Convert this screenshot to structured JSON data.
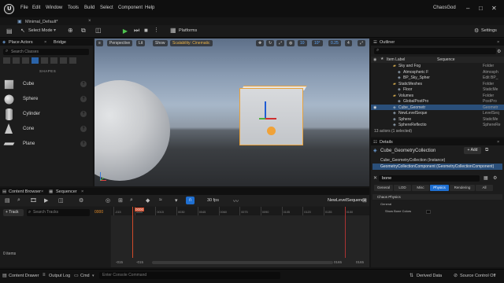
{
  "menubar": {
    "items": [
      "File",
      "Edit",
      "Window",
      "Tools",
      "Build",
      "Select",
      "Component",
      "Help"
    ],
    "project_tab": "Minimal_Default*",
    "window_title": "ChaosGod"
  },
  "toolbar": {
    "select_mode": "Select Mode",
    "platforms": "Platforms",
    "settings": "Settings"
  },
  "place_actors": {
    "tab_label": "Place Actors",
    "bridge_tab": "Bridge",
    "search_placeholder": "Search Classes",
    "section": "SHAPES",
    "shapes": [
      {
        "name": "Cube",
        "icon": "cube-icon"
      },
      {
        "name": "Sphere",
        "icon": "sphere-icon"
      },
      {
        "name": "Cylinder",
        "icon": "cylinder-icon"
      },
      {
        "name": "Cone",
        "icon": "cone-icon"
      },
      {
        "name": "Plane",
        "icon": "plane-icon"
      }
    ]
  },
  "viewport": {
    "perspective": "Perspective",
    "lit": "Lit",
    "show": "Show",
    "scalability": "Scalability: Cinematic",
    "grid_snap": "10",
    "rotation_snap": "10°",
    "scale_snap": "0.25",
    "camera_speed": "4"
  },
  "outliner": {
    "tab_label": "Outliner",
    "col_label": "Item Label",
    "col_sequence": "Sequence",
    "rows": [
      {
        "name": "Sky and Fog",
        "type": "Folder",
        "indent": 1
      },
      {
        "name": "Atmospheric F",
        "type": "Atmosph",
        "indent": 2
      },
      {
        "name": "BP_Sky_Spher",
        "type": "Edit BP_",
        "indent": 2
      },
      {
        "name": "StaticMeshes",
        "type": "Folder",
        "indent": 1
      },
      {
        "name": "Floor",
        "type": "StaticMe",
        "indent": 2
      },
      {
        "name": "Volumes",
        "type": "Folder",
        "indent": 1
      },
      {
        "name": "GlobalPostPro",
        "type": "PostPro",
        "indent": 2
      },
      {
        "name": "Cube_Geometr",
        "type": "Geometr",
        "indent": 1,
        "selected": true
      },
      {
        "name": "NewLevelSeque",
        "type": "LevelSeq",
        "indent": 1
      },
      {
        "name": "Sphere",
        "type": "StaticMe",
        "indent": 1
      },
      {
        "name": "SphereReflectio",
        "type": "SphereRe",
        "indent": 1
      }
    ],
    "status": "13 actors (1 selected)"
  },
  "details": {
    "tab_label": "Details",
    "object_name": "Cube_GeometryCollection",
    "add_label": "+ Add",
    "components": [
      "Cube_GeometryCollection (Instance)",
      "GeometryCollectionComponent (GeometryCollectionComponent)"
    ],
    "filter_value": "bone",
    "tabs": [
      "General",
      "LOD",
      "Misc",
      "Physics",
      "Rendering",
      "All"
    ],
    "active_tab": "Physics",
    "section": "Chaos Physics",
    "subsection": "General",
    "property": "Show Bone Colors"
  },
  "content_browser": {
    "tab_label": "Content Browser",
    "sequencer_tab": "Sequencer"
  },
  "sequencer": {
    "fps": "30 fps",
    "sequence_name": "NewLevelSequence",
    "add_track": "+ Track",
    "search_placeholder": "Search Tracks",
    "current_frame": "0000",
    "playhead_label": "0000",
    "ticks": [
      "-015",
      "0000",
      "0015",
      "0030",
      "0045",
      "0060",
      "0075",
      "0090",
      "0105",
      "0120",
      "0135",
      "0150"
    ],
    "range_start": "-015",
    "range_start2": "-015",
    "range_end": "0165",
    "range_end2": "0165",
    "items": "0 items"
  },
  "statusbar": {
    "content_drawer": "Content Drawer",
    "output_log": "Output Log",
    "cmd": "Cmd",
    "cmd_placeholder": "Enter Console Command",
    "derived_data": "Derived Data",
    "source_control": "Source Control Off"
  }
}
